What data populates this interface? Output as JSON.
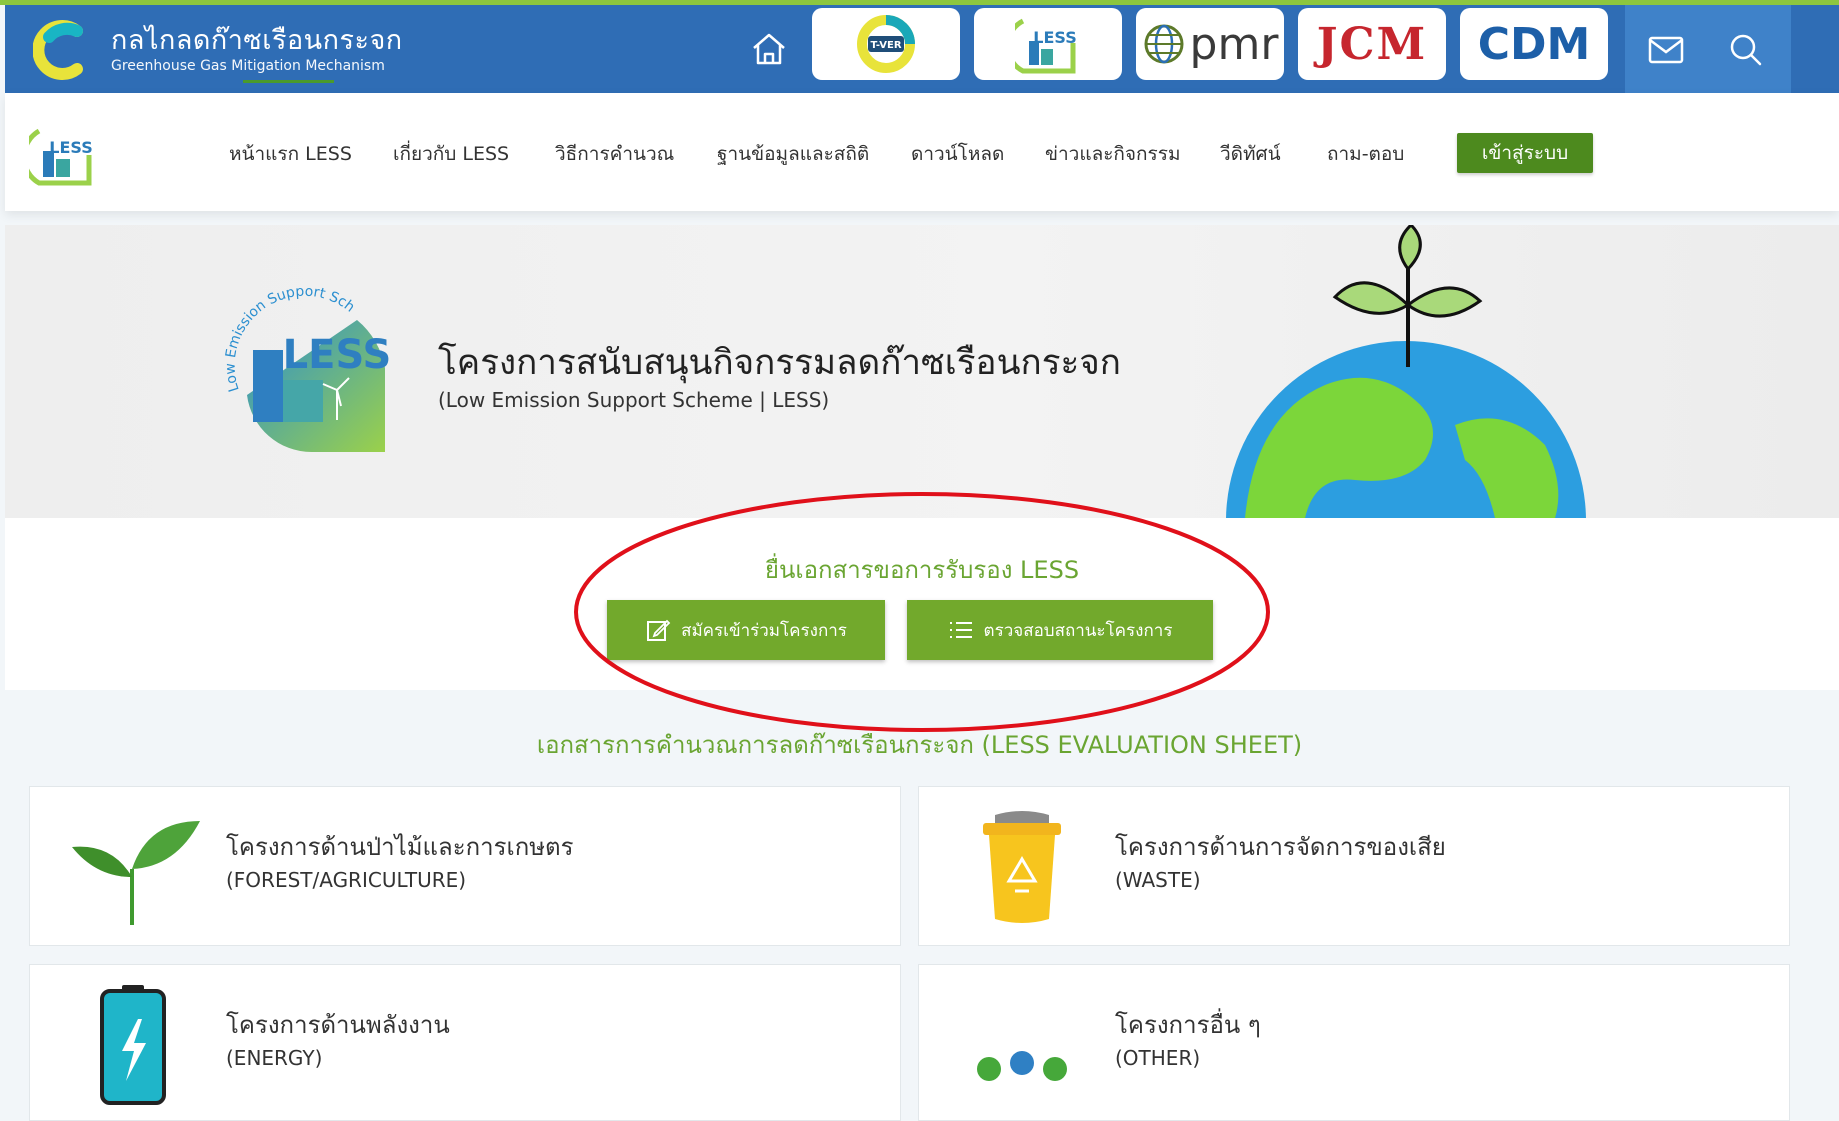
{
  "header": {
    "brand_name": "กลไกลดก๊าซเรือนกระจก",
    "brand_sub": "Greenhouse Gas Mitigation Mechanism",
    "partners": {
      "tver_label": "T-VER",
      "less_label": "LESS",
      "pmr_label": "pmr",
      "jcm_label": "JCM",
      "cdm_label": "CDM"
    }
  },
  "nav": {
    "logo_label": "LESS",
    "items": [
      {
        "label": "หน้าแรก LESS"
      },
      {
        "label": "เกี่ยวกับ LESS"
      },
      {
        "label": "วิธีการคำนวณ"
      },
      {
        "label": "ฐานข้อมูลและสถิติ"
      },
      {
        "label": "ดาวน์โหลด"
      },
      {
        "label": "ข่าวและกิจกรรม"
      },
      {
        "label": "วีดิทัศน์"
      },
      {
        "label": "ถาม-ตอบ"
      }
    ],
    "login_label": "เข้าสู่ระบบ"
  },
  "hero": {
    "logo_arc_text": "Low Emission Support Scheme",
    "logo_label": "LESS",
    "title": "โครงการสนับสนุนกิจกรรมลดก๊าซเรือนกระจก",
    "subtitle": "(Low Emission Support Scheme | LESS)"
  },
  "cta": {
    "title": "ยื่นเอกสารขอการรับรอง LESS",
    "apply_label": "สมัครเข้าร่วมโครงการ",
    "status_label": "ตรวจสอบสถานะโครงการ"
  },
  "evaluation": {
    "title": "เอกสารการคำนวณการลดก๊าซเรือนกระจก (LESS EVALUATION SHEET)",
    "cards": [
      {
        "title": "โครงการด้านป่าไม้และการเกษตร",
        "sub": "(FOREST/AGRICULTURE)",
        "icon": "sprout-icon"
      },
      {
        "title": "โครงการด้านการจัดการของเสีย",
        "sub": "(WASTE)",
        "icon": "recycle-bin-icon"
      },
      {
        "title": "โครงการด้านพลังงาน",
        "sub": "(ENERGY)",
        "icon": "battery-icon"
      },
      {
        "title": "โครงการอื่น ๆ",
        "sub": "(OTHER)",
        "icon": "dots-icon"
      }
    ]
  },
  "colors": {
    "topbar": "#2f6db5",
    "accent_green": "#72a92c",
    "annotation_red": "#e0101a"
  }
}
